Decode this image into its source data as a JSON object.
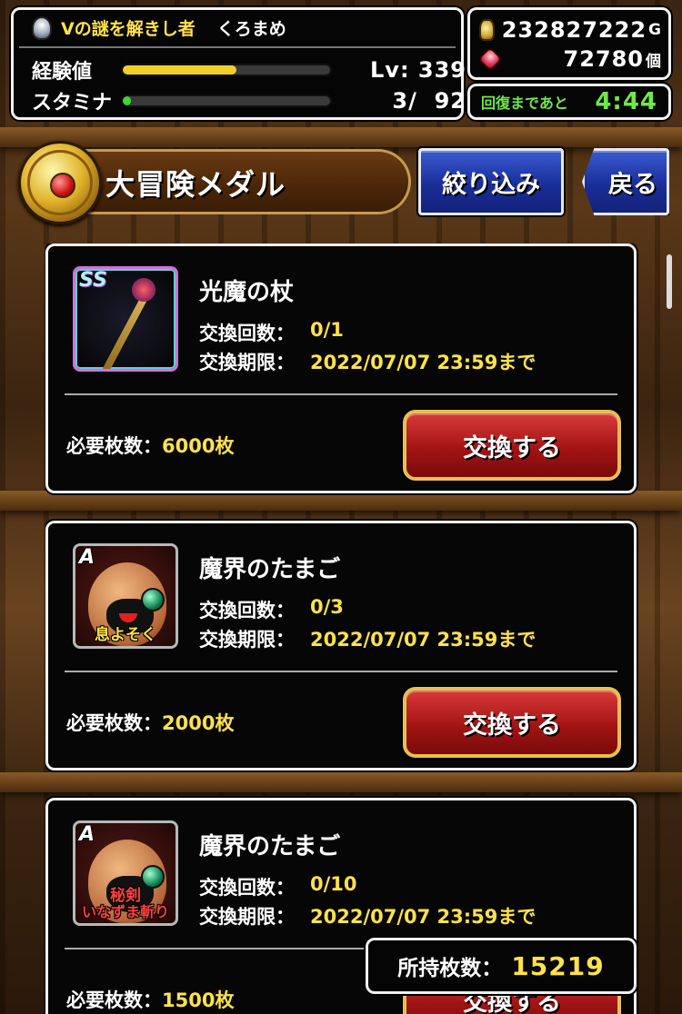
{
  "status": {
    "title": "Vの謎を解きし者",
    "player_name": "くろまめ",
    "exp_label": "経験値",
    "exp_progress": 0.55,
    "level_text": "Lv: 339",
    "stamina_label": "スタミナ",
    "stamina_progress": 0.03,
    "stamina_text": "3/  92"
  },
  "currency": {
    "gold": "232827222",
    "gold_unit": "G",
    "gems": "72780",
    "gems_unit": "個"
  },
  "recovery": {
    "label": "回復まであと",
    "time": "4:44"
  },
  "header": {
    "title": "大冒険メダル",
    "filter_label": "絞り込み",
    "back_label": "戻る"
  },
  "labels": {
    "exchange_count": "交換回数：",
    "exchange_deadline": "交換期限：",
    "required": "必要枚数：",
    "exchange_button": "交換する"
  },
  "items": [
    {
      "rank": "SS",
      "name": "光魔の杖",
      "count": "0/1",
      "deadline": "2022/07/07 23:59まで",
      "required": "6000枚",
      "skill": ""
    },
    {
      "rank": "A",
      "name": "魔界のたまご",
      "count": "0/3",
      "deadline": "2022/07/07 23:59まで",
      "required": "2000枚",
      "skill": "息よそく"
    },
    {
      "rank": "A",
      "name": "魔界のたまご",
      "count": "0/10",
      "deadline": "2022/07/07 23:59まで",
      "required": "1500枚",
      "skill_top": "秘剣",
      "skill": "いなずま斬り"
    }
  ],
  "owned": {
    "label": "所持枚数：",
    "value": "15219"
  },
  "colors": {
    "exp_bar": "#f2d02a",
    "stamina_bar": "#3ad83a",
    "highlight_text": "#ffe24a",
    "recovery_text": "#6fe84a",
    "exchange_button": "#b01818",
    "header_button": "#1a2e9a"
  }
}
